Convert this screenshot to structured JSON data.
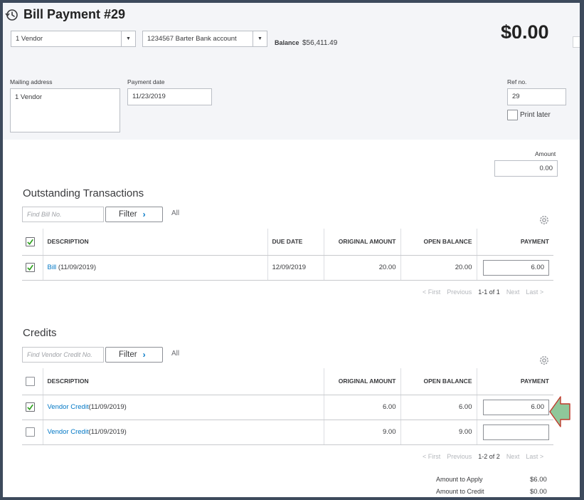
{
  "title": "Bill Payment #29",
  "payee": {
    "value": "1 Vendor"
  },
  "bank_account": {
    "value": "1234567 Barter Bank account"
  },
  "balance": {
    "label": "Balance",
    "value": "$56,411.49"
  },
  "total_amount": "$0.00",
  "mailing_address": {
    "label": "Mailing address",
    "value": "1 Vendor"
  },
  "payment_date": {
    "label": "Payment date",
    "value": "11/23/2019"
  },
  "ref_no": {
    "label": "Ref no.",
    "value": "29"
  },
  "print_later": {
    "label": "Print later",
    "checked": false
  },
  "amount": {
    "label": "Amount",
    "value": "0.00"
  },
  "outstanding": {
    "title": "Outstanding Transactions",
    "search_placeholder": "Find Bill No.",
    "filter_label": "Filter",
    "all_label": "All",
    "columns": {
      "description": "DESCRIPTION",
      "due_date": "DUE DATE",
      "original_amount": "ORIGINAL AMOUNT",
      "open_balance": "OPEN BALANCE",
      "payment": "PAYMENT"
    },
    "header_checked": true,
    "rows": [
      {
        "checked": true,
        "link": "Bill",
        "date": "(11/09/2019)",
        "due_date": "12/09/2019",
        "original_amount": "20.00",
        "open_balance": "20.00",
        "payment": "6.00"
      }
    ],
    "pager": {
      "first": "< First",
      "previous": "Previous",
      "range": "1-1 of 1",
      "next": "Next",
      "last": "Last >"
    }
  },
  "credits": {
    "title": "Credits",
    "search_placeholder": "Find Vendor Credit No.",
    "filter_label": "Filter",
    "all_label": "All",
    "columns": {
      "description": "DESCRIPTION",
      "original_amount": "ORIGINAL AMOUNT",
      "open_balance": "OPEN BALANCE",
      "payment": "PAYMENT"
    },
    "header_checked": false,
    "rows": [
      {
        "checked": true,
        "link": "Vendor Credit",
        "date": "(11/09/2019)",
        "original_amount": "6.00",
        "open_balance": "6.00",
        "payment": "6.00"
      },
      {
        "checked": false,
        "link": "Vendor Credit",
        "date": "(11/09/2019)",
        "original_amount": "9.00",
        "open_balance": "9.00",
        "payment": ""
      }
    ],
    "pager": {
      "first": "< First",
      "previous": "Previous",
      "range": "1-2 of 2",
      "next": "Next",
      "last": "Last >"
    }
  },
  "summary": {
    "amount_to_apply": {
      "label": "Amount to Apply",
      "value": "$6.00"
    },
    "amount_to_credit": {
      "label": "Amount to Credit",
      "value": "$0.00"
    }
  },
  "colors": {
    "link": "#0077c5",
    "check": "#2ca01c",
    "annotation_arrow_fill": "#8fc79a",
    "annotation_arrow_stroke": "#c0392b"
  },
  "icons": [
    "history-clock-icon",
    "chevron-down-icon",
    "chevron-right-icon",
    "gear-icon",
    "checkmark-icon",
    "annotation-arrow-icon"
  ]
}
